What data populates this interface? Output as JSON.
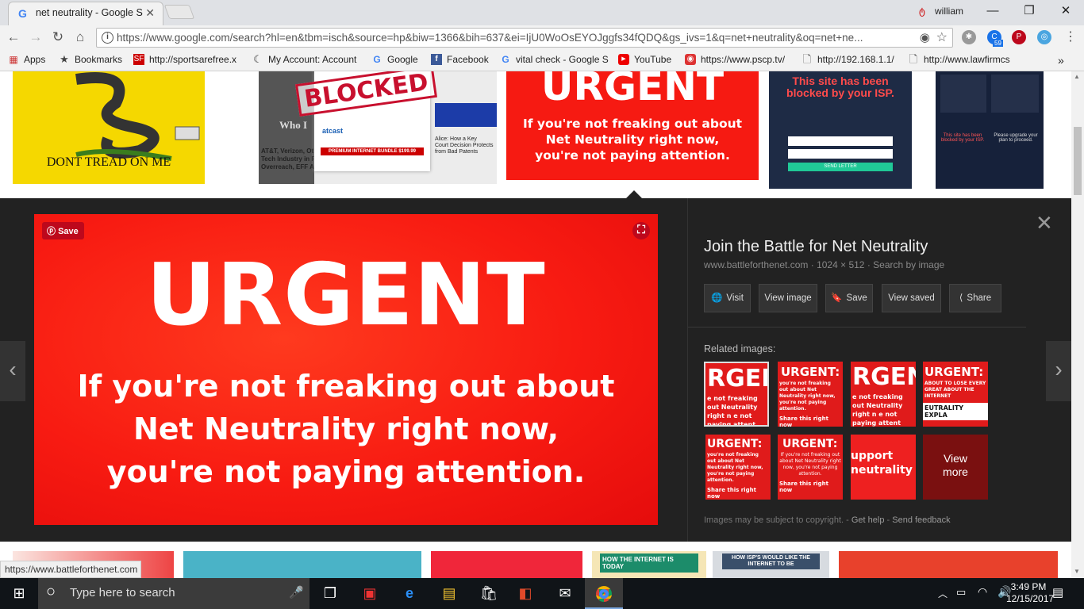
{
  "browser": {
    "tab_title": "net neutrality - Google S",
    "user": "william",
    "url": "https://www.google.com/search?hl=en&tbm=isch&source=hp&biw=1366&bih=637&ei=IjU0WoOsEYOJggfs34fQDQ&gs_ivs=1&q=net+neutrality&oq=net+ne...",
    "ext_badge": "59"
  },
  "bookmarks": [
    {
      "label": "Apps",
      "icon": "apps-icon"
    },
    {
      "label": "Bookmarks",
      "icon": "star-icon"
    },
    {
      "label": "http://sportsarefree.x",
      "icon": "sf-icon"
    },
    {
      "label": "My Account: Account",
      "icon": "comcast-icon"
    },
    {
      "label": "Google",
      "icon": "google-icon"
    },
    {
      "label": "Facebook",
      "icon": "facebook-icon"
    },
    {
      "label": "vital check - Google S",
      "icon": "google-icon"
    },
    {
      "label": "YouTube",
      "icon": "youtube-icon"
    },
    {
      "label": "https://www.pscp.tv/",
      "icon": "periscope-icon"
    },
    {
      "label": "http://192.168.1.1/",
      "icon": "page-icon"
    },
    {
      "label": "http://www.lawfirmcs",
      "icon": "page-icon"
    }
  ],
  "results_top": {
    "thumb1_caption": "DONT TREAD ON ME",
    "thumb2_caption": "BLOCKED",
    "thumb2_lines": [
      "Who I",
      "AT&T, Verizon, Oth",
      "Tech Industry in Pr",
      "Overreach, EFF An",
      "Alice: How a Key",
      "Court Decision Protects",
      "from Bad Patents",
      "atcast",
      "PREMIUM INTERNET BUNDLE $199.99"
    ],
    "thumb3_title": "URGENT",
    "thumb3_sub": "If you're not freaking out about Net Neutrality right now, you're not paying attention.",
    "thumb4_title": "This site has been blocked by your ISP.",
    "thumb4_button": "SEND LETTER",
    "thumb5_text": "This site has been blocked by your ISP.",
    "thumb5_text2": "Please upgrade your plan to proceed."
  },
  "viewer": {
    "save_label": "Save",
    "image_headline": "URGENT",
    "image_subline1": "If you're not freaking out about",
    "image_subline2": "Net Neutrality right now,",
    "image_subline3": "you're not paying attention.",
    "title": "Join the Battle for Net Neutrality",
    "meta_domain": "www.battleforthenet.com",
    "meta_size": "1024 × 512",
    "meta_search": "Search by image",
    "buttons": [
      "Visit",
      "View image",
      "Save",
      "View saved",
      "Share"
    ],
    "related_label": "Related images:",
    "related": [
      "RGEN",
      "URGENT:",
      "RGEN",
      "URGENT:",
      "URGENT:",
      "URGENT:",
      "upport neutrality",
      "View more"
    ],
    "related_sub": [
      "e not freaking out Neutrality right n e not paying attent",
      "you're not freaking out about Net Neutrality right now, you're not paying attention.",
      "e not freaking out Neutrality right n e not paying attent",
      "ABOUT TO LOSE EVERY GREAT ABOUT THE INTERNET",
      "you're not freaking out about Net Neutrality right now, you're not paying attention.",
      "If you're not freaking out about Net Neutrality right now, you're not paying attention."
    ],
    "related_footer": [
      "Share this right now",
      "Share this right now",
      "Share this right now"
    ],
    "related_tag": "EUTRALITY EXPLA",
    "footer_notice": "Images may be subject to copyright.",
    "footer_help": "Get help",
    "footer_feedback": "Send feedback"
  },
  "results_bottom": {
    "label1": "HOW THE INTERNET IS TODAY",
    "label2": "HOW ISP'S WOULD LIKE THE INTERNET TO BE"
  },
  "status_url": "https://www.battleforthenet.com",
  "taskbar": {
    "search_placeholder": "Type here to search",
    "time": "3:49 PM",
    "date": "12/15/2017"
  },
  "colors": {
    "red": "#f81b12",
    "pinterest": "#bd081c",
    "dark": "#222222"
  }
}
